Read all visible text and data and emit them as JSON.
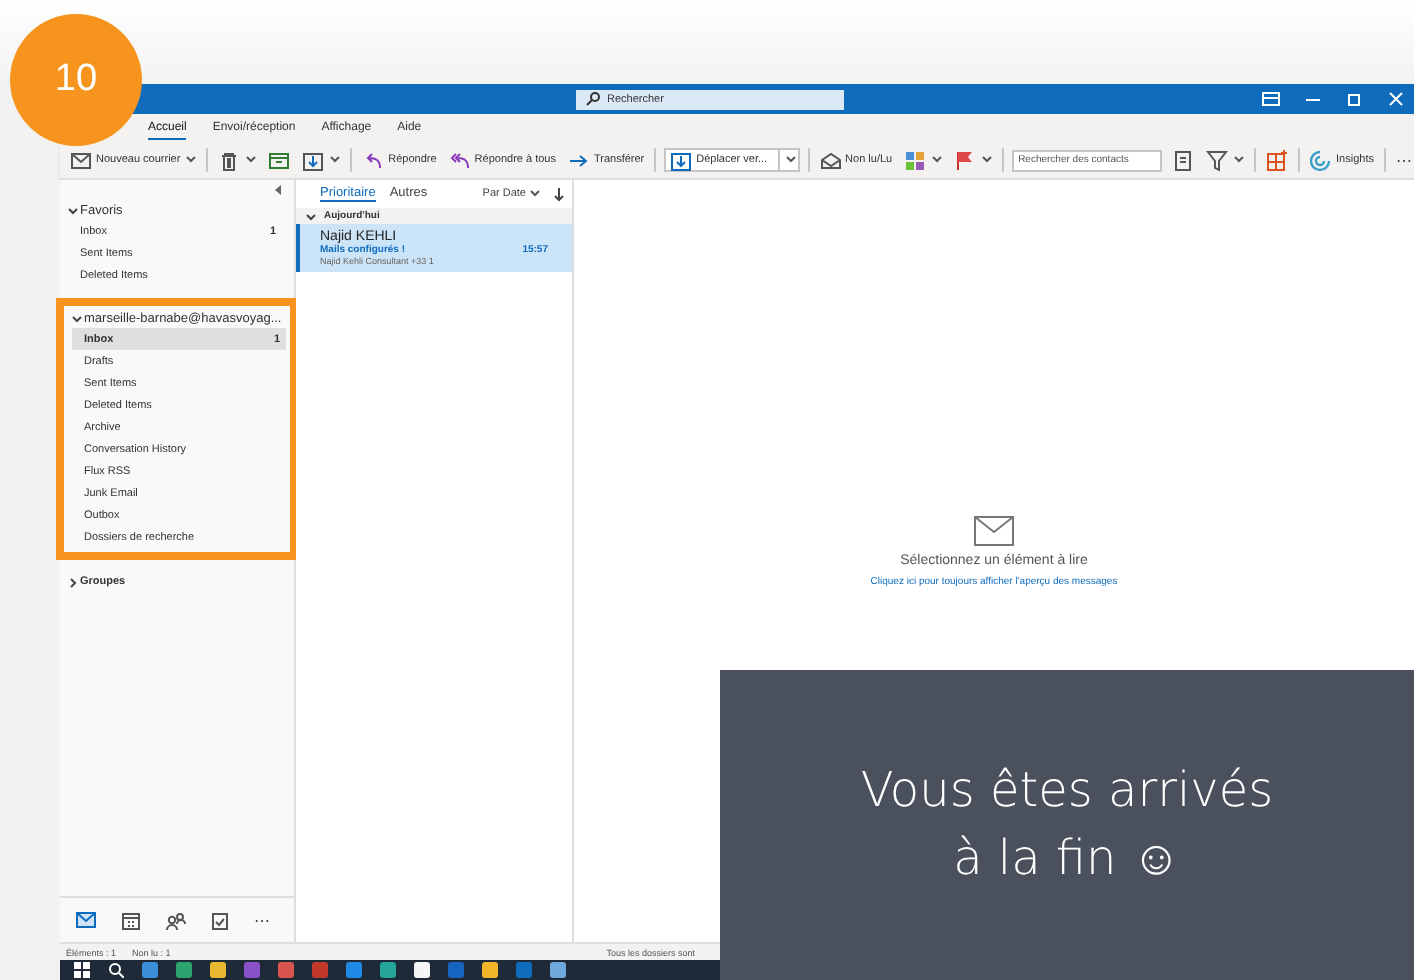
{
  "step_badge": "10",
  "window": {
    "search_placeholder": "Rechercher"
  },
  "ribbon_tabs": [
    {
      "label": "Accueil",
      "selected": true
    },
    {
      "label": "Envoi/réception",
      "selected": false
    },
    {
      "label": "Affichage",
      "selected": false
    },
    {
      "label": "Aide",
      "selected": false
    }
  ],
  "toolbar_groups": [
    [
      {
        "kind": "button",
        "label": "Nouveau courrier",
        "dropdown": true
      }
    ],
    [
      {
        "kind": "icon",
        "dropdown": true
      },
      {
        "kind": "icon",
        "dropdown": false
      },
      {
        "kind": "icon",
        "dropdown": true
      }
    ],
    [
      {
        "kind": "button",
        "label": "Répondre",
        "dropdown": false
      },
      {
        "kind": "button",
        "label": "Répondre à tous",
        "dropdown": false
      },
      {
        "kind": "button",
        "label": "Transférer",
        "dropdown": false
      }
    ],
    [
      {
        "kind": "combo",
        "label": "Déplacer ver..."
      }
    ],
    [
      {
        "kind": "button",
        "label": "Non lu/Lu",
        "dropdown": false
      },
      {
        "kind": "icon",
        "dropdown": true
      },
      {
        "kind": "icon",
        "dropdown": true
      }
    ],
    [
      {
        "kind": "field",
        "placeholder": "Rechercher des contacts"
      },
      {
        "kind": "icon",
        "dropdown": false
      },
      {
        "kind": "icon",
        "dropdown": true
      }
    ],
    [
      {
        "kind": "icon",
        "dropdown": false
      }
    ],
    [
      {
        "kind": "button",
        "label": "Insights",
        "dropdown": false
      }
    ],
    [
      {
        "kind": "text",
        "label": "⋯"
      }
    ]
  ],
  "folder_pane": {
    "sections": [
      {
        "label": "Favoris",
        "expanded": true,
        "highlighted": false,
        "items": [
          {
            "label": "Inbox",
            "count": "1",
            "selected": false
          },
          {
            "label": "Sent Items",
            "selected": false
          },
          {
            "label": "Deleted Items",
            "selected": false
          }
        ]
      },
      {
        "label": "marseille-barnabe@havasvoyag...",
        "expanded": true,
        "highlighted": true,
        "items": [
          {
            "label": "Inbox",
            "count": "1",
            "selected": true
          },
          {
            "label": "Drafts",
            "selected": false
          },
          {
            "label": "Sent Items",
            "selected": false
          },
          {
            "label": "Deleted Items",
            "selected": false
          },
          {
            "label": "Archive",
            "selected": false
          },
          {
            "label": "Conversation History",
            "selected": false
          },
          {
            "label": "Flux RSS",
            "selected": false
          },
          {
            "label": "Junk Email",
            "selected": false
          },
          {
            "label": "Outbox",
            "selected": false
          },
          {
            "label": "Dossiers de recherche",
            "selected": false
          }
        ]
      },
      {
        "label": "Groupes",
        "expanded": false,
        "highlighted": false
      }
    ],
    "nav_more": "⋯"
  },
  "message_list": {
    "tabs": [
      {
        "label": "Prioritaire",
        "selected": true
      },
      {
        "label": "Autres",
        "selected": false
      }
    ],
    "sort": "Par Date",
    "group": "Aujourd'hui",
    "messages": [
      {
        "sender": "Najid KEHLI",
        "subject": "Mails configurés !",
        "time": "15:57",
        "preview": "Najid Kehli  Consultant  +33 1",
        "selected": true
      }
    ]
  },
  "reading_pane": {
    "message": "Sélectionnez un élément à lire",
    "link": "Cliquez ici pour toujours afficher l'aperçu des messages"
  },
  "status_bar": {
    "left": [
      "Éléments : 1",
      "Non lu : 1"
    ],
    "right": "Tous les dossiers sont"
  },
  "overlay": {
    "text": "Vous êtes arrivés à la fin ☺"
  }
}
